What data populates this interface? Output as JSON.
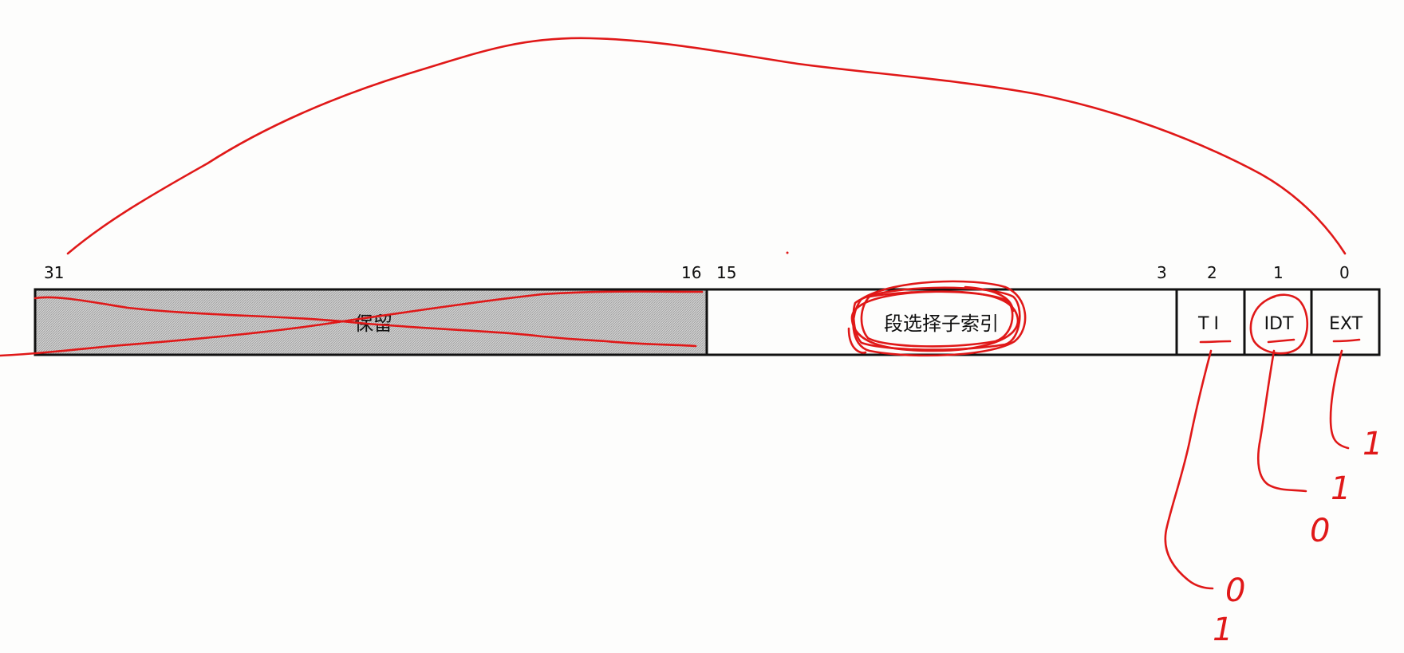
{
  "bit_numbers": {
    "b31": "31",
    "b16": "16",
    "b15": "15",
    "b3": "3",
    "b2": "2",
    "b1": "1",
    "b0": "0"
  },
  "fields": {
    "reserved": "保留",
    "selector_index": "段选择子索引",
    "ti": "TI",
    "idt": "IDT",
    "ext": "EXT"
  },
  "annotations": {
    "ti_value_a": "0",
    "ti_value_b": "1",
    "idt_value_a": "1",
    "idt_value_b": "0",
    "ext_value": "1"
  },
  "colors": {
    "ink": "#e01818",
    "reserved_fill": "#c8c8c8",
    "border": "#111111"
  }
}
